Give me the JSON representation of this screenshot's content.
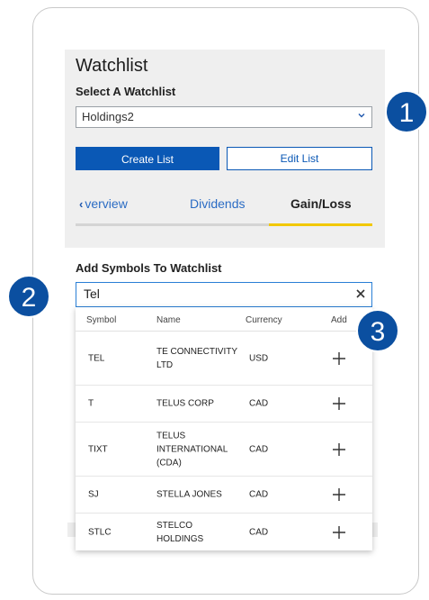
{
  "watchlist": {
    "title": "Watchlist",
    "select_label": "Select A Watchlist",
    "selected": "Holdings2",
    "create_label": "Create List",
    "edit_label": "Edit List",
    "tabs": [
      {
        "label": "verview",
        "arrow": "‹"
      },
      {
        "label": "Dividends"
      },
      {
        "label": "Gain/Loss",
        "active": true
      }
    ]
  },
  "add_symbols": {
    "title": "Add Symbols To Watchlist",
    "query": "Tel",
    "headers": {
      "symbol": "Symbol",
      "name": "Name",
      "currency": "Currency",
      "add": "Add"
    },
    "results": [
      {
        "symbol": "TEL",
        "name": "TE CONNECTIVITY LTD",
        "currency": "USD"
      },
      {
        "symbol": "T",
        "name": "TELUS CORP",
        "currency": "CAD"
      },
      {
        "symbol": "TIXT",
        "name": "TELUS INTERNATIONAL (CDA)",
        "currency": "CAD"
      },
      {
        "symbol": "SJ",
        "name": "STELLA JONES",
        "currency": "CAD"
      },
      {
        "symbol": "STLC",
        "name": "STELCO HOLDINGS",
        "currency": "CAD"
      }
    ]
  },
  "callouts": [
    "1",
    "2",
    "3"
  ],
  "colors": {
    "primary": "#0a58b5",
    "callout": "#0b4fa0",
    "active_tab": "#f2c800"
  }
}
